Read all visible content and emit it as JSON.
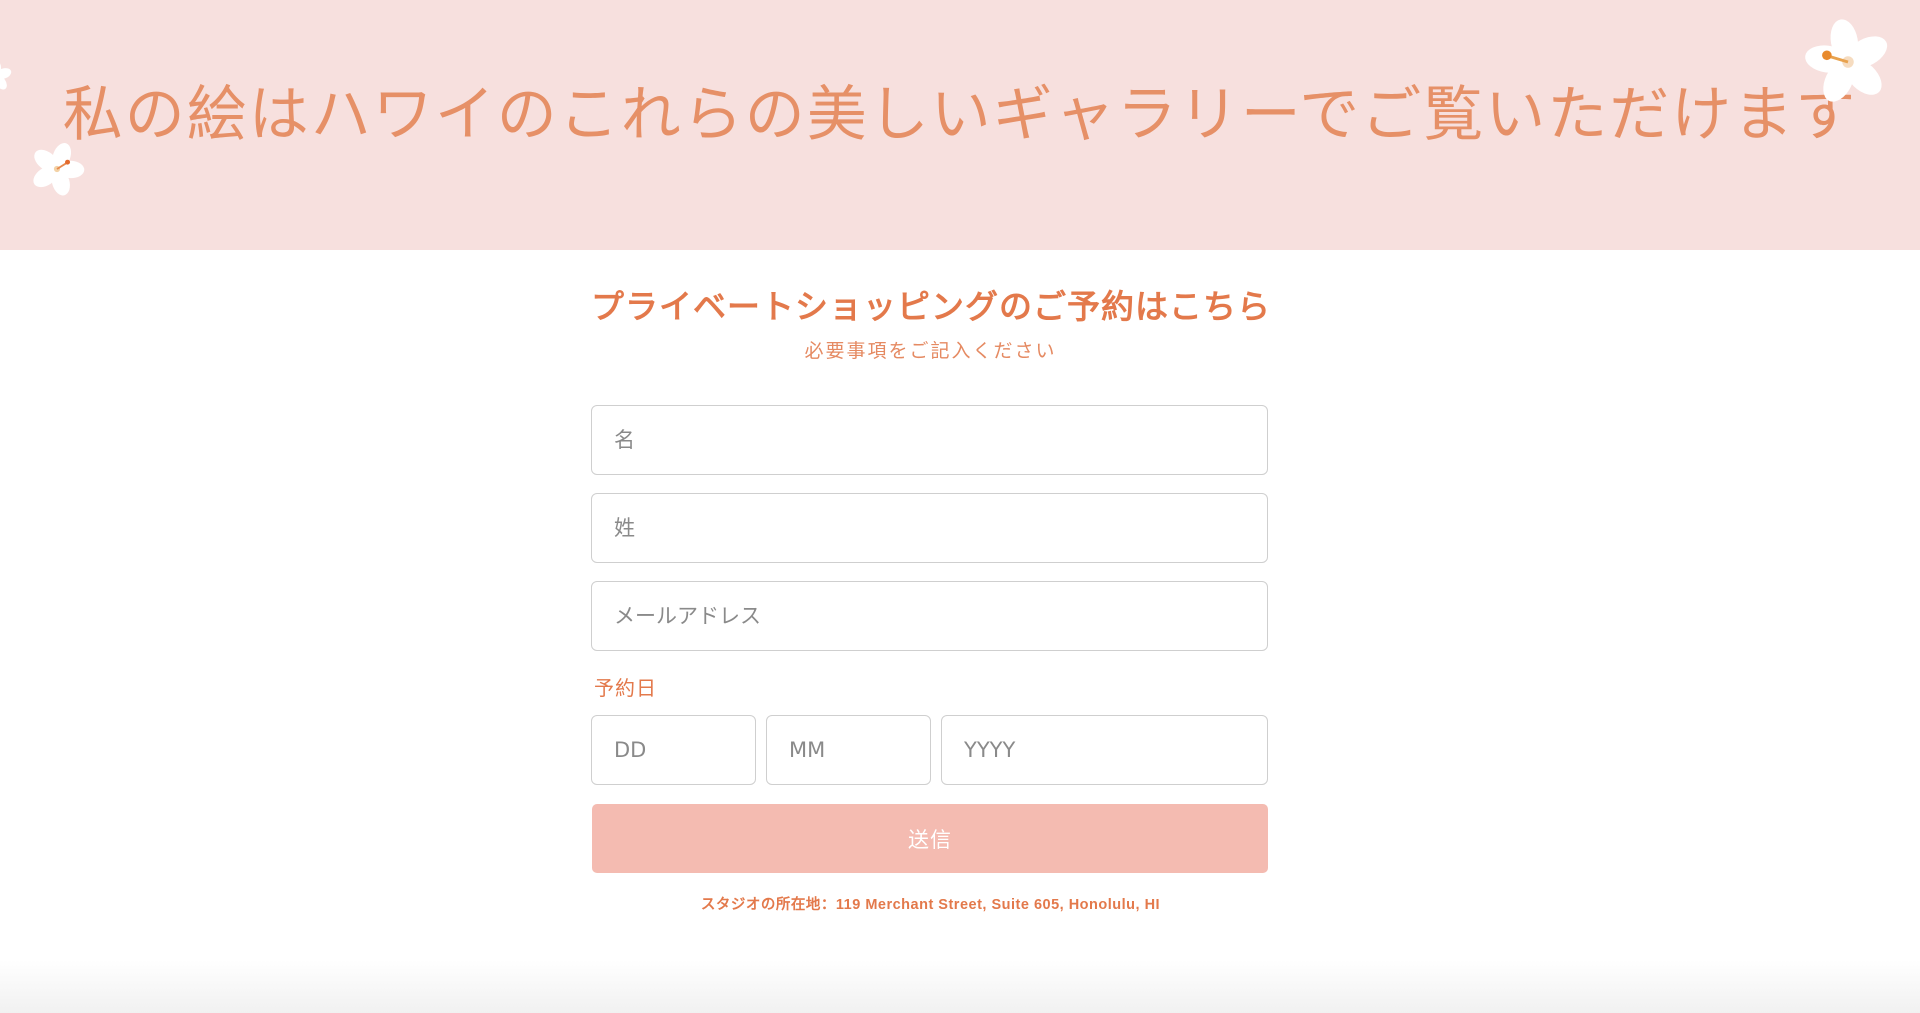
{
  "banner": {
    "title": "私の絵はハワイのこれらの美しいギャラリーでご覧いただけます",
    "background_color": "#f7e0de",
    "title_color": "#e69067",
    "decorations": [
      "flower-icon",
      "flower-icon",
      "flower-icon"
    ]
  },
  "form": {
    "heading": "プライベートショッピングのご予約はこちら",
    "subheading": "必要事項をご記入ください",
    "first_name": {
      "value": "",
      "placeholder": "名"
    },
    "last_name": {
      "value": "",
      "placeholder": "姓"
    },
    "email": {
      "value": "",
      "placeholder": "メールアドレス"
    },
    "date_label": "予約日",
    "day": {
      "value": "",
      "placeholder": "DD"
    },
    "month": {
      "value": "",
      "placeholder": "MM"
    },
    "year": {
      "value": "",
      "placeholder": "YYYY"
    },
    "submit_label": "送信",
    "address": "スタジオの所在地：119 Merchant Street, Suite 605, Honolulu, HI"
  },
  "colors": {
    "accent": "#e3794b",
    "button": "#f4bbb1",
    "input_border": "#cfcfcf"
  }
}
